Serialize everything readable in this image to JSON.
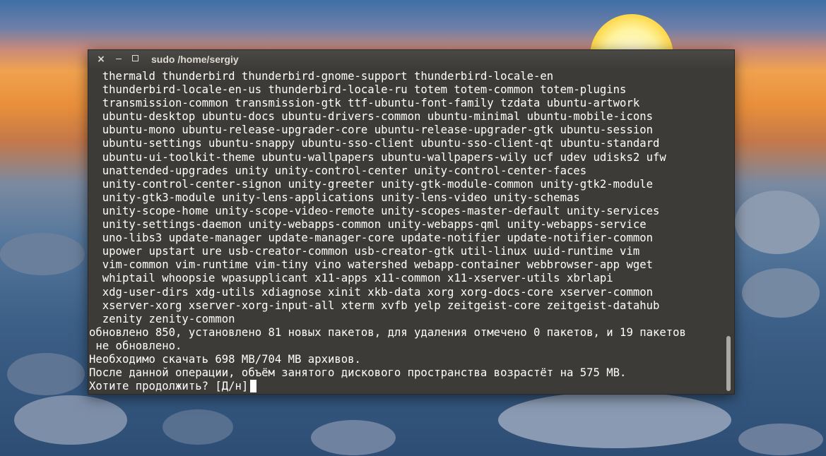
{
  "window": {
    "title": "sudo  /home/sergiy",
    "close_glyph": "×"
  },
  "terminal": {
    "lines": [
      "  thermald thunderbird thunderbird-gnome-support thunderbird-locale-en",
      "  thunderbird-locale-en-us thunderbird-locale-ru totem totem-common totem-plugins",
      "  transmission-common transmission-gtk ttf-ubuntu-font-family tzdata ubuntu-artwork",
      "  ubuntu-desktop ubuntu-docs ubuntu-drivers-common ubuntu-minimal ubuntu-mobile-icons",
      "  ubuntu-mono ubuntu-release-upgrader-core ubuntu-release-upgrader-gtk ubuntu-session",
      "  ubuntu-settings ubuntu-snappy ubuntu-sso-client ubuntu-sso-client-qt ubuntu-standard",
      "  ubuntu-ui-toolkit-theme ubuntu-wallpapers ubuntu-wallpapers-wily ucf udev udisks2 ufw",
      "  unattended-upgrades unity unity-control-center unity-control-center-faces",
      "  unity-control-center-signon unity-greeter unity-gtk-module-common unity-gtk2-module",
      "  unity-gtk3-module unity-lens-applications unity-lens-video unity-schemas",
      "  unity-scope-home unity-scope-video-remote unity-scopes-master-default unity-services",
      "  unity-settings-daemon unity-webapps-common unity-webapps-qml unity-webapps-service",
      "  uno-libs3 update-manager update-manager-core update-notifier update-notifier-common",
      "  upower upstart ure usb-creator-common usb-creator-gtk util-linux uuid-runtime vim",
      "  vim-common vim-runtime vim-tiny vino watershed webapp-container webbrowser-app wget",
      "  whiptail whoopsie wpasupplicant x11-apps x11-common x11-xserver-utils xbrlapi",
      "  xdg-user-dirs xdg-utils xdiagnose xinit xkb-data xorg xorg-docs-core xserver-common",
      "  xserver-xorg xserver-xorg-input-all xterm xvfb yelp zeitgeist-core zeitgeist-datahub",
      "  zenity zenity-common",
      "обновлено 850, установлено 81 новых пакетов, для удаления отмечено 0 пакетов, и 19 пакетов",
      " не обновлено.",
      "Необходимо скачать 698 MB/704 MB архивов.",
      "После данной операции, объём занятого дискового пространства возрастёт на 575 MB.",
      "Хотите продолжить? [Д/н]"
    ]
  },
  "colors": {
    "terminal_bg": "#3c3b37",
    "terminal_text": "#ffffff",
    "titlebar_text": "#dfdbd2"
  }
}
